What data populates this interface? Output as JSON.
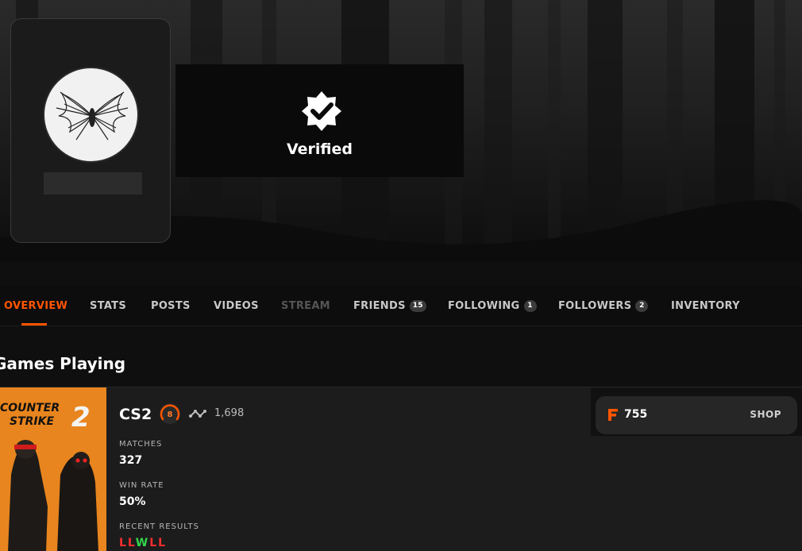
{
  "profile": {
    "verified_label": "Verified"
  },
  "nav": {
    "items": [
      {
        "label": "OVERVIEW"
      },
      {
        "label": "STATS"
      },
      {
        "label": "POSTS"
      },
      {
        "label": "VIDEOS"
      },
      {
        "label": "STREAM"
      },
      {
        "label": "FRIENDS",
        "count": "15"
      },
      {
        "label": "FOLLOWING",
        "count": "1"
      },
      {
        "label": "FOLLOWERS",
        "count": "2"
      },
      {
        "label": "INVENTORY"
      }
    ]
  },
  "games": {
    "title": "Games Playing",
    "cover": {
      "line1": "COUNTER",
      "line2": "STRIKE",
      "number": "2"
    },
    "game_name": "CS2",
    "level": "8",
    "elo": "1,698",
    "matches_label": "MATCHES",
    "matches_value": "327",
    "win_rate_label": "WIN RATE",
    "win_rate_value": "50%",
    "recent_label": "RECENT RESULTS",
    "recent_results": [
      "L",
      "L",
      "W",
      "L",
      "L"
    ]
  },
  "shop": {
    "points": "755",
    "button_label": "SHOP"
  },
  "colors": {
    "accent": "#ff5500",
    "win": "#32d74b",
    "loss": "#ff2d2d"
  }
}
